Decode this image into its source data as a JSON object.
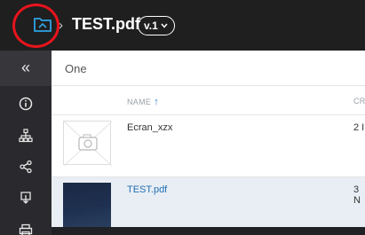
{
  "header": {
    "document_title": "TEST.pdf",
    "version_label": "v.1",
    "separator": "›",
    "highlight_color": "#e8141c"
  },
  "sidebar": {
    "collapse_glyph": "«",
    "icons": [
      "collapse-icon",
      "info-icon",
      "hierarchy-icon",
      "share-icon",
      "download-icon",
      "print-icon"
    ]
  },
  "browser": {
    "path_label": "One",
    "columns": {
      "name": "NAME",
      "created": "CR"
    },
    "rows": [
      {
        "name": "Ecran_xzx",
        "created": "2 I",
        "thumbnail": "camera-placeholder"
      },
      {
        "name": "TEST.pdf",
        "created": "3 N",
        "thumbnail": "dark-image",
        "selected": true
      }
    ]
  },
  "colors": {
    "accent": "#1f6fb5",
    "sort_arrow": "#2e7fd0",
    "folder_icon": "#2fa4e7"
  }
}
